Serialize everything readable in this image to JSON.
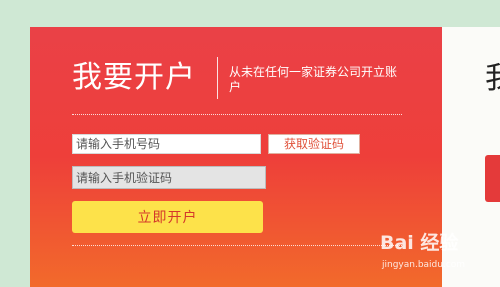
{
  "card": {
    "title": "我要开户",
    "subtitle": "从未在任何一家证券公司开立账户",
    "phone_placeholder": "请输入手机号码",
    "get_code_label": "获取验证码",
    "code_placeholder": "请输入手机验证码",
    "open_account_label": "立即开户"
  },
  "side_panel": {
    "title_partial": "我"
  },
  "watermark": {
    "logo_text": "Bai 经验",
    "url": "jingyan.baidu.com"
  },
  "colors": {
    "background": "#cfe8d4",
    "card_top": "#ea4147",
    "card_bottom": "#f26a2b",
    "open_button": "#fde24a",
    "open_button_text": "#d4382b",
    "code_button_text": "#e0513a"
  }
}
